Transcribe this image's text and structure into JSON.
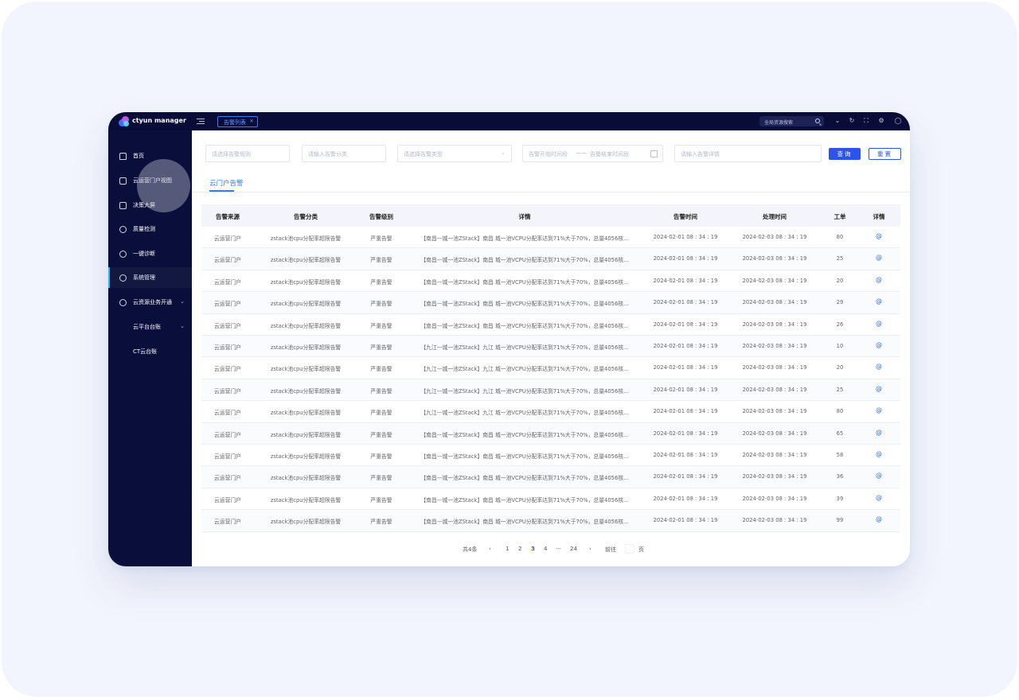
{
  "app": {
    "name": "ctyun manager",
    "tab_active": "告警列表",
    "tab_close": "×",
    "search_placeholder": "全局资源搜索"
  },
  "topbar_icons": [
    "chevron-down-icon",
    "refresh-icon",
    "fullscreen-icon",
    "settings-icon",
    "user-icon"
  ],
  "sidebar": {
    "items": [
      {
        "label": "首页",
        "icon": "home-icon"
      },
      {
        "label": "云运营门户视图",
        "icon": "cube-icon"
      },
      {
        "label": "决策大屏",
        "icon": "screen-icon"
      },
      {
        "label": "质量检测",
        "icon": "gauge-icon"
      },
      {
        "label": "一键诊断",
        "icon": "diagnose-icon"
      },
      {
        "label": "系统管理",
        "icon": "settings-icon",
        "active": true
      },
      {
        "label": "云资源业务开通",
        "icon": "settings-icon",
        "expandable": true
      },
      {
        "label": "云平台台账",
        "expandable": true,
        "sub": true
      },
      {
        "label": "CT云台账",
        "sub": true
      }
    ]
  },
  "filters": {
    "rule_placeholder": "请选择告警规则",
    "category_placeholder": "请输入告警分类",
    "type_placeholder": "请选择告警类型",
    "start_placeholder": "告警开始时间段",
    "range_sep": "——",
    "end_placeholder": "告警结束时间段",
    "detail_placeholder": "请输入告警详情",
    "query_label": "查询",
    "reset_label": "重置"
  },
  "tabs": {
    "cloud_portal": "云门户告警"
  },
  "table": {
    "headers": [
      "告警来源",
      "告警分类",
      "告警级别",
      "详情",
      "告警时间",
      "处理时间",
      "工单",
      "详情"
    ],
    "rows": [
      [
        "云运营门户",
        "zstack池cpu分配率超限告警",
        "严重告警",
        "【南昌—城一池ZStack】南昌 城一池VCPU分配率达到71%大于70%，总量4056核...",
        "2024-02-01 08 : 34 : 19",
        "2024-02-03 08 : 34 : 19",
        "80"
      ],
      [
        "云运营门户",
        "zstack池cpu分配率超限告警",
        "严重告警",
        "【南昌—城一池ZStack】南昌 城一池VCPU分配率达到71%大于70%，总量4056核...",
        "2024-02-01 08 : 34 : 19",
        "2024-02-03 08 : 34 : 19",
        "25"
      ],
      [
        "云运营门户",
        "zstack池cpu分配率超限告警",
        "严重告警",
        "【南昌—城一池ZStack】南昌 城一池VCPU分配率达到71%大于70%，总量4056核...",
        "2024-02-01 08 : 34 : 19",
        "2024-02-03 08 : 34 : 19",
        "20"
      ],
      [
        "云运营门户",
        "zstack池cpu分配率超限告警",
        "严重告警",
        "【南昌—城一池ZStack】南昌 城一池VCPU分配率达到71%大于70%，总量4056核...",
        "2024-02-01 08 : 34 : 19",
        "2024-02-03 08 : 34 : 19",
        "29"
      ],
      [
        "云运营门户",
        "zstack池cpu分配率超限告警",
        "严重告警",
        "【南昌—城一池ZStack】南昌 城一池VCPU分配率达到71%大于70%，总量4056核...",
        "2024-02-01 08 : 34 : 19",
        "2024-02-03 08 : 34 : 19",
        "26"
      ],
      [
        "云运营门户",
        "zstack池cpu分配率超限告警",
        "严重告警",
        "【九江—城一池ZStack】九江 城一池VCPU分配率达到71%大于70%，总量4056核...",
        "2024-02-01 08 : 34 : 19",
        "2024-02-03 08 : 34 : 19",
        "10"
      ],
      [
        "云运营门户",
        "zstack池cpu分配率超限告警",
        "严重告警",
        "【九江—城一池ZStack】九江 城一池VCPU分配率达到71%大于70%，总量4056核...",
        "2024-02-01 08 : 34 : 19",
        "2024-02-03 08 : 34 : 19",
        "20"
      ],
      [
        "云运营门户",
        "zstack池cpu分配率超限告警",
        "严重告警",
        "【九江—城一池ZStack】九江 城一池VCPU分配率达到71%大于70%，总量4056核...",
        "2024-02-01 08 : 34 : 19",
        "2024-02-03 08 : 34 : 19",
        "25"
      ],
      [
        "云运营门户",
        "zstack池cpu分配率超限告警",
        "严重告警",
        "【九江—城一池ZStack】九江 城一池VCPU分配率达到71%大于70%，总量4056核...",
        "2024-02-01 08 : 34 : 19",
        "2024-02-03 08 : 34 : 19",
        "80"
      ],
      [
        "云运营门户",
        "zstack池cpu分配率超限告警",
        "严重告警",
        "【南昌—城一池ZStack】南昌 城一池VCPU分配率达到71%大于70%，总量4056核...",
        "2024-02-01 08 : 34 : 19",
        "2024-02-03 08 : 34 : 19",
        "65"
      ],
      [
        "云运营门户",
        "zstack池cpu分配率超限告警",
        "严重告警",
        "【南昌—城一池ZStack】南昌 城一池VCPU分配率达到71%大于70%，总量4056核...",
        "2024-02-01 08 : 34 : 19",
        "2024-02-03 08 : 34 : 19",
        "58"
      ],
      [
        "云运营门户",
        "zstack池cpu分配率超限告警",
        "严重告警",
        "【南昌—城一池ZStack】南昌 城一池VCPU分配率达到71%大于70%，总量4056核...",
        "2024-02-01 08 : 34 : 19",
        "2024-02-03 08 : 34 : 19",
        "36"
      ],
      [
        "云运营门户",
        "zstack池cpu分配率超限告警",
        "严重告警",
        "【南昌—城一池ZStack】南昌 城一池VCPU分配率达到71%大于70%，总量4056核...",
        "2024-02-01 08 : 34 : 19",
        "2024-02-03 08 : 34 : 19",
        "39"
      ],
      [
        "云运营门户",
        "zstack池cpu分配率超限告警",
        "严重告警",
        "【南昌—城一池ZStack】南昌 城一池VCPU分配率达到71%大于70%，总量4056核...",
        "2024-02-01 08 : 34 : 19",
        "2024-02-03 08 : 34 : 19",
        "99"
      ]
    ],
    "detail_icon": "@"
  },
  "pagination": {
    "total": "共4条",
    "prev": "‹",
    "pages": [
      "1",
      "2",
      "3",
      "4",
      "···",
      "24"
    ],
    "current": "3",
    "next": "›",
    "goto_label": "前往",
    "page_suffix": "页"
  },
  "colors": {
    "topbar_bg": "#080c36",
    "sidebar_bg": "#0a0e3a",
    "primary": "#2d54e8",
    "tab_accent": "#2d7cf0",
    "page_bg": "#f2f5fd"
  }
}
